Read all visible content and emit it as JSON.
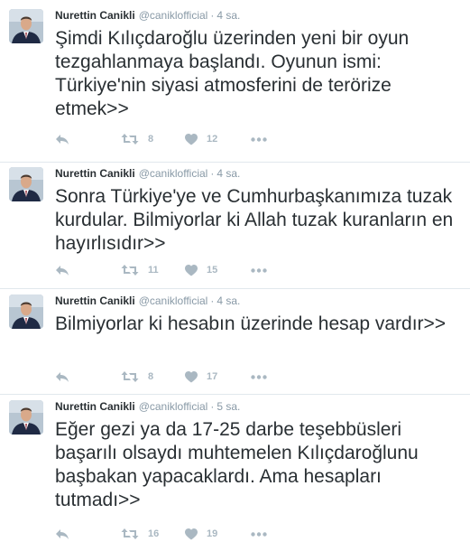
{
  "tweets": [
    {
      "name": "Nurettin Canikli",
      "handle": "@caniklofficial",
      "time": "4 sa.",
      "text": "Şimdi Kılıçdaroğlu üzerinden yeni bir oyun tezgahlanmaya başlandı. Oyunun ismi: Türkiye'nin siyasi atmosferini de terörize etmek>>",
      "retweets": "8",
      "likes": "12"
    },
    {
      "name": "Nurettin Canikli",
      "handle": "@caniklofficial",
      "time": "4 sa.",
      "text": "Sonra Türkiye'ye ve Cumhurbaşkanımıza tuzak kurdular. Bilmiyorlar ki Allah tuzak kuranların en hayırlısıdır>>",
      "retweets": "11",
      "likes": "15"
    },
    {
      "name": "Nurettin Canikli",
      "handle": "@caniklofficial",
      "time": "4 sa.",
      "text": "Bilmiyorlar ki hesabın üzerinde hesap vardır>>",
      "retweets": "8",
      "likes": "17"
    },
    {
      "name": "Nurettin Canikli",
      "handle": "@caniklofficial",
      "time": "5 sa.",
      "text": "Eğer gezi ya da 17-25 darbe teşebbüsleri başarılı olsaydı muhtemelen Kılıçdaroğlunu başbakan yapacaklardı. Ama hesapları tutmadı>>",
      "retweets": "16",
      "likes": "19"
    }
  ],
  "separator": "·",
  "icons": {
    "reply": "reply-icon",
    "retweet": "retweet-icon",
    "like": "heart-icon",
    "more": "more-dots-icon"
  },
  "colors": {
    "text": "#292f33",
    "meta": "#8899a6",
    "action": "#aab8c2",
    "divider": "#e1e8ed"
  }
}
